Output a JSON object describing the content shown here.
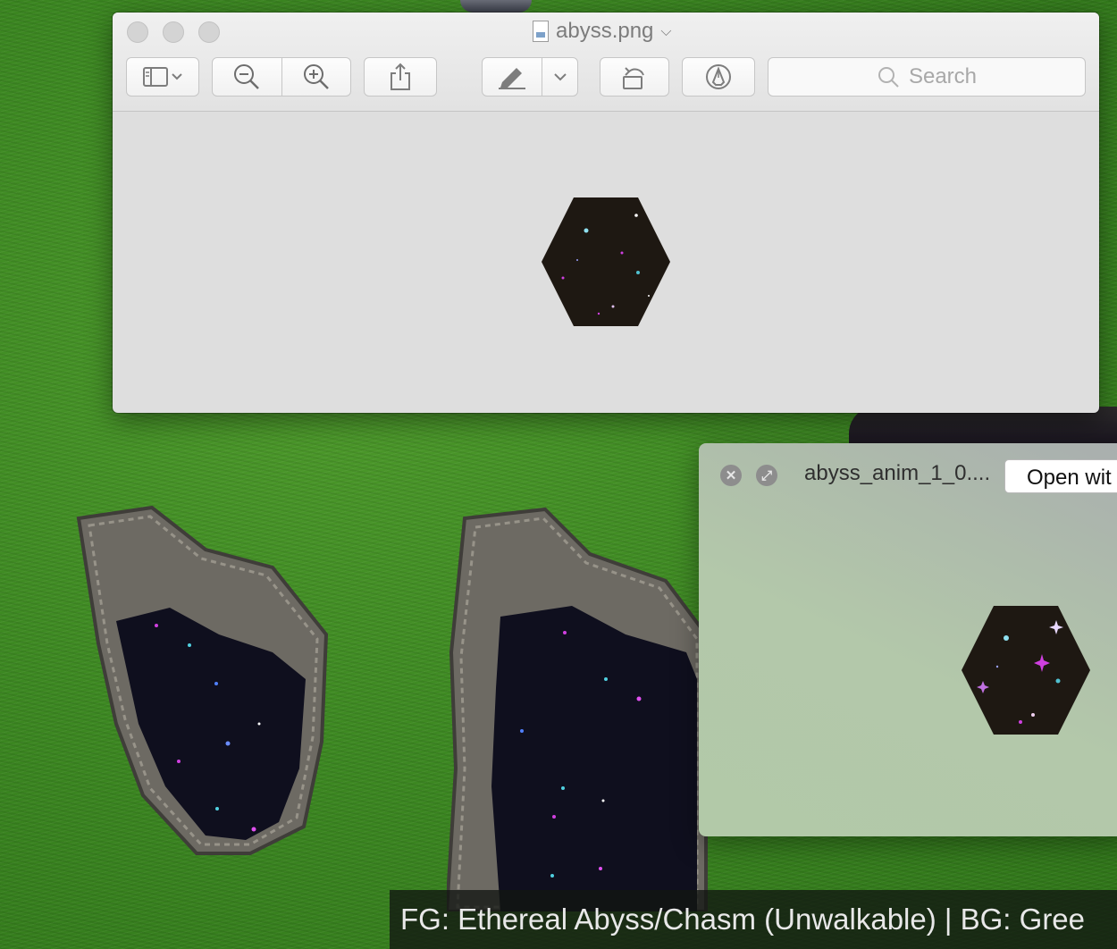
{
  "game": {
    "caption": "FG: Ethereal Abyss/Chasm (Unwalkable) | BG: Gree"
  },
  "preview_window": {
    "title": "abyss.png",
    "toolbar": {
      "sidebar": "sidebar-icon",
      "zoom_out": "zoom-out-icon",
      "zoom_in": "zoom-in-icon",
      "share": "share-icon",
      "markup": "highlighter-icon",
      "rotate": "rotate-left-icon",
      "annotate": "markup-icon"
    },
    "search_placeholder": "Search"
  },
  "quicklook_window": {
    "title": "abyss_anim_1_0....",
    "open_with_label": "Open wit"
  },
  "colors": {
    "grass": "#3c8a22",
    "abyss": "#1e1812",
    "star_pink": "#d040e0",
    "star_cyan": "#50d0e0"
  }
}
